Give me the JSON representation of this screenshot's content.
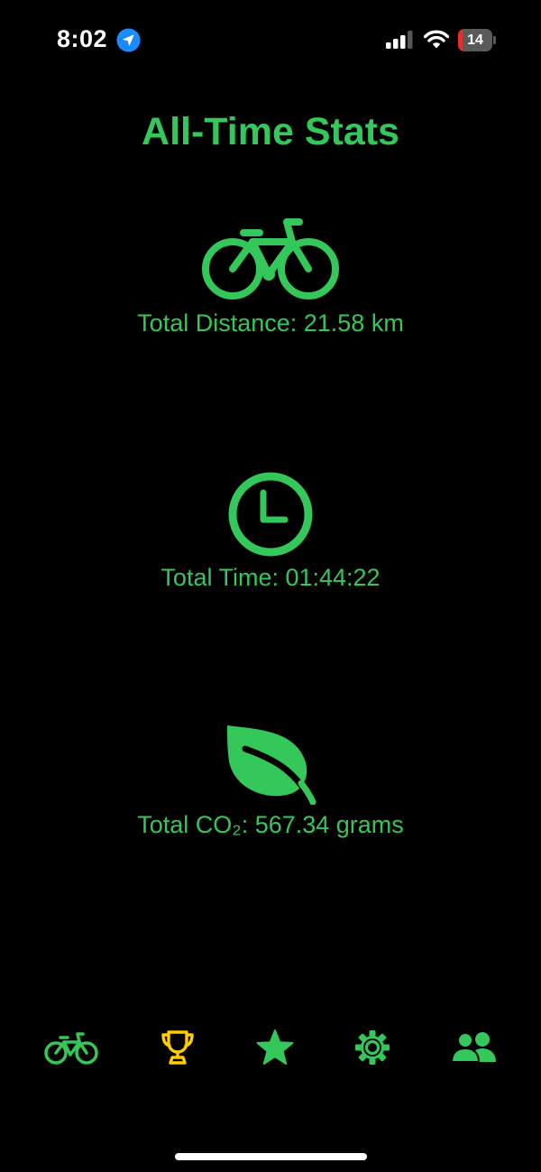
{
  "status_bar": {
    "time": "8:02",
    "battery_level": "14",
    "icons": [
      "location-arrow-icon",
      "cellular-signal-icon",
      "wifi-icon",
      "battery-icon"
    ]
  },
  "main": {
    "title": "All-Time Stats",
    "stats": [
      {
        "icon": "bicycle-icon",
        "label": "Total Distance: 21.58 km"
      },
      {
        "icon": "clock-icon",
        "label": "Total Time: 01:44:22"
      },
      {
        "icon": "leaf-icon",
        "label": "Total CO₂: 567.34 grams"
      }
    ]
  },
  "tab_bar": {
    "tabs": [
      {
        "icon": "bicycle-icon",
        "color": "#34c759"
      },
      {
        "icon": "trophy-icon",
        "color": "#ffcc00"
      },
      {
        "icon": "star-icon",
        "color": "#34c759"
      },
      {
        "icon": "gear-icon",
        "color": "#34c759"
      },
      {
        "icon": "people-icon",
        "color": "#34c759"
      }
    ]
  },
  "colors": {
    "accent": "#34c759",
    "trophy": "#ffcc00",
    "background": "#000000",
    "battery_low": "#e5302a",
    "location_blue": "#1a8cff"
  },
  "battery_fill_fraction": 0.14
}
